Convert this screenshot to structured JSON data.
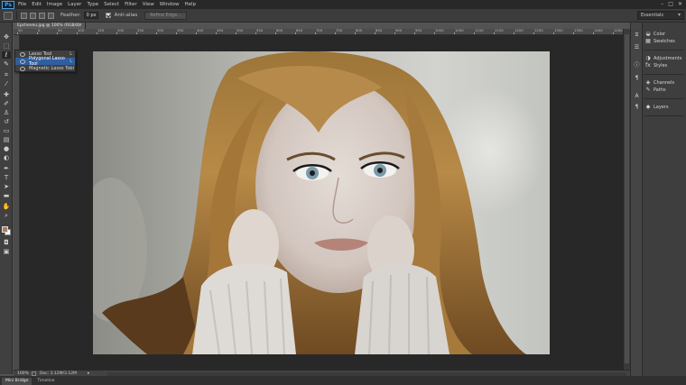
{
  "app": {
    "logo": "Ps"
  },
  "menu": [
    "File",
    "Edit",
    "Image",
    "Layer",
    "Type",
    "Select",
    "Filter",
    "View",
    "Window",
    "Help"
  ],
  "window_controls": [
    "–",
    "□",
    "✕"
  ],
  "options": {
    "feather_label": "Feather:",
    "feather_value": "0 px",
    "anti_alias_label": "Anti-alias",
    "anti_alias_checked": true,
    "refine_edge_label": "Refine Edge...",
    "workspace": "Essentials"
  },
  "document": {
    "tab_title": "Epcheveu.jpg @ 100% (RGB/8)",
    "zoom": "100%",
    "doc_info": "Doc: 3.12M/3.12M"
  },
  "ruler": {
    "labels": [
      "50",
      "0",
      "50",
      "100",
      "150",
      "200",
      "250",
      "300",
      "350",
      "400",
      "450",
      "500",
      "550",
      "600",
      "650",
      "700",
      "750",
      "800",
      "850",
      "900",
      "950",
      "1000",
      "1050",
      "1100",
      "1150",
      "1200",
      "1250",
      "1300",
      "1350",
      "1400",
      "1450"
    ]
  },
  "lasso_flyout": {
    "items": [
      {
        "label": "Lasso Tool",
        "key": "L",
        "selected": false
      },
      {
        "label": "Polygonal Lasso Tool",
        "key": "L",
        "selected": true
      },
      {
        "label": "Magnetic Lasso Tool",
        "key": "L",
        "selected": false
      }
    ]
  },
  "tools": {
    "foreground_color": "#b07a5a",
    "background_color": "#ffffff"
  },
  "right_panels": {
    "groups": [
      [
        "Color",
        "Swatches"
      ],
      [
        "Adjustments",
        "Styles"
      ],
      [
        "Channels",
        "Paths"
      ],
      [
        "Layers"
      ]
    ]
  },
  "bottom_tabs": [
    "Mini Bridge",
    "Timeline"
  ],
  "colors": {
    "accent": "#2f5fa0",
    "app_bg": "#535353",
    "canvas_bg": "#282828"
  }
}
